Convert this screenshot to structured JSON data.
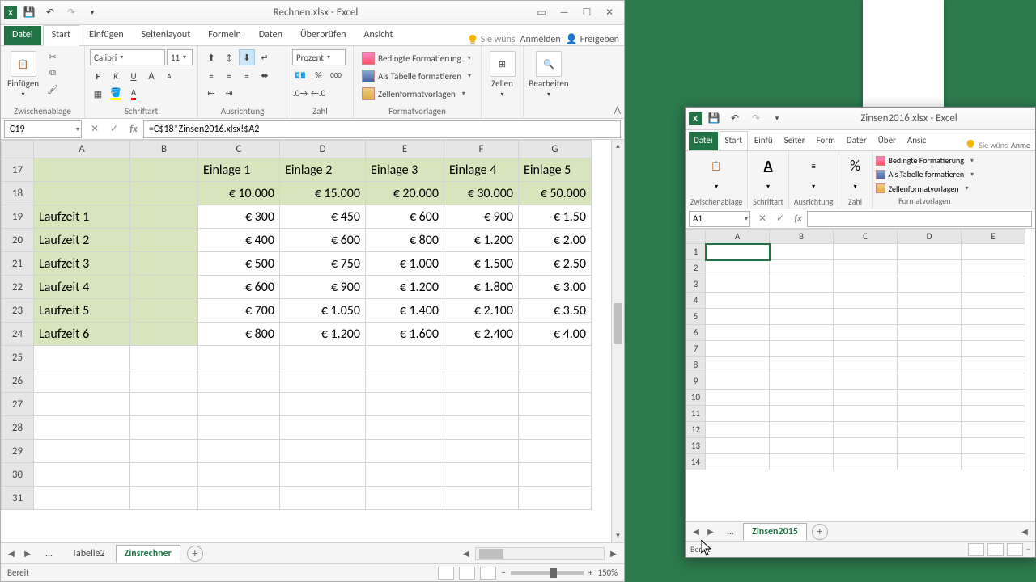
{
  "left": {
    "title": "Rechnen.xlsx - Excel",
    "tabs": {
      "file": "Datei",
      "start": "Start",
      "einf": "Einfügen",
      "layout": "Seitenlayout",
      "form": "Formeln",
      "daten": "Daten",
      "pruef": "Überprüfen",
      "ansicht": "Ansicht"
    },
    "ribbon_right": {
      "wish": "Sie wüns",
      "anmelden": "Anmelden",
      "freigeben": "Freigeben"
    },
    "groups": {
      "zwisch": "Zwischenablage",
      "schrift": "Schriftart",
      "ausr": "Ausrichtung",
      "zahl": "Zahl",
      "format": "Formatvorlagen",
      "zellen": "Zellen",
      "bearb": "Bearbeiten"
    },
    "einfuegen": "Einfügen",
    "font_name": "Calibri",
    "font_size": "11",
    "numfmt": "Prozent",
    "fv": {
      "bed": "Bedingte Formatierung",
      "tab": "Als Tabelle formatieren",
      "zellv": "Zellenformatvorlagen"
    },
    "zellen_lbl": "Zellen",
    "bearb_lbl": "Bearbeiten",
    "namebox": "C19",
    "formula": "=C$18*Zinsen2016.xlsx!$A2",
    "cols": [
      "A",
      "B",
      "C",
      "D",
      "E",
      "F",
      "G"
    ],
    "rows": [
      17,
      18,
      19,
      20,
      21,
      22,
      23,
      24,
      25,
      26,
      27,
      28,
      29,
      30,
      31
    ],
    "col_headers": {
      "C": "Einlage 1",
      "D": "Einlage 2",
      "E": "Einlage 3",
      "F": "Einlage 4",
      "G": "Einlage 5"
    },
    "amount_hdr": {
      "C": "€ 10.000",
      "D": "€ 15.000",
      "E": "€ 20.000",
      "F": "€ 30.000",
      "G": "€ 50.000"
    },
    "data_rows": [
      {
        "r": 19,
        "lab": "Laufzeit 1",
        "C": "€ 300",
        "D": "€ 450",
        "E": "€ 600",
        "F": "€ 900",
        "G": "€ 1.50"
      },
      {
        "r": 20,
        "lab": "Laufzeit 2",
        "C": "€ 400",
        "D": "€ 600",
        "E": "€ 800",
        "F": "€ 1.200",
        "G": "€ 2.00"
      },
      {
        "r": 21,
        "lab": "Laufzeit 3",
        "C": "€ 500",
        "D": "€ 750",
        "E": "€ 1.000",
        "F": "€ 1.500",
        "G": "€ 2.50"
      },
      {
        "r": 22,
        "lab": "Laufzeit 4",
        "C": "€ 600",
        "D": "€ 900",
        "E": "€ 1.200",
        "F": "€ 1.800",
        "G": "€ 3.00"
      },
      {
        "r": 23,
        "lab": "Laufzeit 5",
        "C": "€ 700",
        "D": "€ 1.050",
        "E": "€ 1.400",
        "F": "€ 2.100",
        "G": "€ 3.50"
      },
      {
        "r": 24,
        "lab": "Laufzeit 6",
        "C": "€ 800",
        "D": "€ 1.200",
        "E": "€ 1.600",
        "F": "€ 2.400",
        "G": "€ 4.00"
      }
    ],
    "sheets": {
      "ellipsis": "...",
      "t2": "Tabelle2",
      "active": "Zinsrechner"
    },
    "status": "Bereit",
    "zoom": "150%"
  },
  "right": {
    "title": "Zinsen2016.xlsx - Excel",
    "tabs": {
      "file": "Datei",
      "start": "Start",
      "einf": "Einfü",
      "layout": "Seiter",
      "form": "Form",
      "daten": "Dater",
      "pruef": "Über",
      "ansicht": "Ansic"
    },
    "ribbon_right": {
      "wish": "Sie wüns",
      "anme": "Anme"
    },
    "groups": {
      "zwisch": "Zwischenablage",
      "schrift": "Schriftart",
      "ausr": "Ausrichtung",
      "zahl": "Zahl",
      "format": "Formatvorlagen"
    },
    "fv": {
      "bed": "Bedingte Formatierung",
      "tab": "Als Tabelle formatieren",
      "zellv": "Zellenformatvorlagen"
    },
    "namebox": "A1",
    "cols": [
      "A",
      "B",
      "C",
      "D",
      "E"
    ],
    "rows": [
      1,
      2,
      3,
      4,
      5,
      6,
      7,
      8,
      9,
      10,
      11,
      12,
      13,
      14
    ],
    "ellipsis": "...",
    "sheet": "Zinsen2015",
    "status": "Bereit"
  }
}
